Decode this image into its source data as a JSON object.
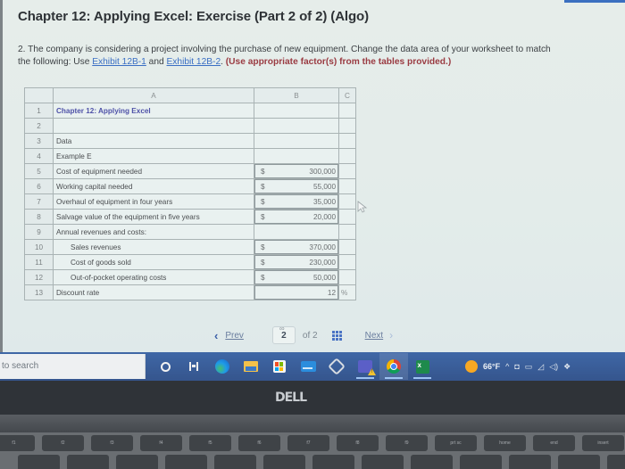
{
  "page": {
    "title": "Chapter 12: Applying Excel: Exercise (Part 2 of 2) (Algo)",
    "question": {
      "number": "2.",
      "text_before": " The company is considering a project involving the purchase of new equipment. Change the data area of your worksheet to match the following: Use ",
      "link1": "Exhibit 12B-1",
      "text_between": " and ",
      "link2": "Exhibit 12B-2",
      "text_after": ". ",
      "note": "(Use appropriate factor(s) from the tables provided.)"
    }
  },
  "spreadsheet": {
    "columns": [
      "",
      "A",
      "B",
      "C"
    ],
    "rows": [
      {
        "num": "1",
        "label": "Chapter 12: Applying Excel",
        "style": "title",
        "dollar": "",
        "value": "",
        "unit": ""
      },
      {
        "num": "2",
        "label": "",
        "style": "",
        "dollar": "",
        "value": "",
        "unit": ""
      },
      {
        "num": "3",
        "label": "Data",
        "style": "",
        "dollar": "",
        "value": "",
        "unit": ""
      },
      {
        "num": "4",
        "label": "Example E",
        "style": "",
        "dollar": "",
        "value": "",
        "unit": ""
      },
      {
        "num": "5",
        "label": "Cost of equipment needed",
        "style": "",
        "dollar": "$",
        "value": "300,000",
        "unit": ""
      },
      {
        "num": "6",
        "label": "Working capital needed",
        "style": "",
        "dollar": "$",
        "value": "55,000",
        "unit": ""
      },
      {
        "num": "7",
        "label": "Overhaul of equipment in four years",
        "style": "",
        "dollar": "$",
        "value": "35,000",
        "unit": ""
      },
      {
        "num": "8",
        "label": "Salvage value of the equipment in five years",
        "style": "",
        "dollar": "$",
        "value": "20,000",
        "unit": ""
      },
      {
        "num": "9",
        "label": "Annual revenues and costs:",
        "style": "",
        "dollar": "",
        "value": "",
        "unit": ""
      },
      {
        "num": "10",
        "label": "Sales revenues",
        "style": "indent",
        "dollar": "$",
        "value": "370,000",
        "unit": ""
      },
      {
        "num": "11",
        "label": "Cost of goods sold",
        "style": "indent",
        "dollar": "$",
        "value": "230,000",
        "unit": ""
      },
      {
        "num": "12",
        "label": "Out-of-pocket operating costs",
        "style": "indent",
        "dollar": "$",
        "value": "50,000",
        "unit": ""
      },
      {
        "num": "13",
        "label": "Discount rate",
        "style": "",
        "dollar": "",
        "value": "12",
        "unit": "%"
      }
    ]
  },
  "pagination": {
    "prev_label": "Prev",
    "current_page": "2",
    "of_label": "of 2",
    "next_label": "Next"
  },
  "taskbar": {
    "search_placeholder": "to search",
    "apps": [
      "cortana",
      "task-view",
      "edge",
      "file-explorer",
      "microsoft-store",
      "mail",
      "dell-support",
      "teams",
      "chrome",
      "excel"
    ],
    "weather_temp": "66°F",
    "tray_icons": [
      "chevron-up",
      "meet-now",
      "battery",
      "wifi",
      "volume",
      "dropbox"
    ]
  },
  "laptop": {
    "brand": "DELL"
  },
  "keyboard": {
    "keys": [
      "f1",
      "f2",
      "f3",
      "f4",
      "f5",
      "f6",
      "f7",
      "f8",
      "f9",
      "prt sc",
      "home",
      "end",
      "insert"
    ]
  }
}
